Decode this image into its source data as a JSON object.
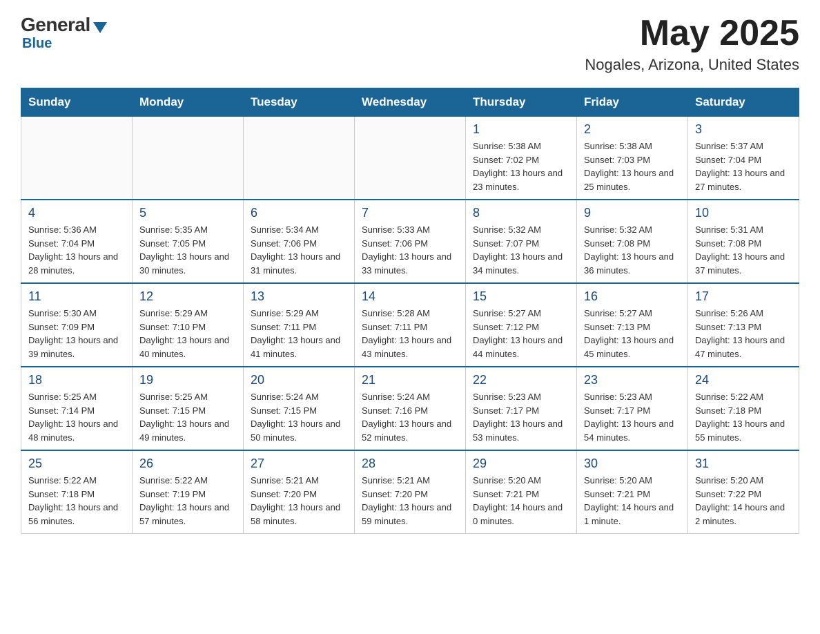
{
  "logo": {
    "general": "General",
    "blue": "Blue"
  },
  "title": "May 2025",
  "subtitle": "Nogales, Arizona, United States",
  "days_of_week": [
    "Sunday",
    "Monday",
    "Tuesday",
    "Wednesday",
    "Thursday",
    "Friday",
    "Saturday"
  ],
  "weeks": [
    [
      {
        "day": "",
        "info": ""
      },
      {
        "day": "",
        "info": ""
      },
      {
        "day": "",
        "info": ""
      },
      {
        "day": "",
        "info": ""
      },
      {
        "day": "1",
        "info": "Sunrise: 5:38 AM\nSunset: 7:02 PM\nDaylight: 13 hours and 23 minutes."
      },
      {
        "day": "2",
        "info": "Sunrise: 5:38 AM\nSunset: 7:03 PM\nDaylight: 13 hours and 25 minutes."
      },
      {
        "day": "3",
        "info": "Sunrise: 5:37 AM\nSunset: 7:04 PM\nDaylight: 13 hours and 27 minutes."
      }
    ],
    [
      {
        "day": "4",
        "info": "Sunrise: 5:36 AM\nSunset: 7:04 PM\nDaylight: 13 hours and 28 minutes."
      },
      {
        "day": "5",
        "info": "Sunrise: 5:35 AM\nSunset: 7:05 PM\nDaylight: 13 hours and 30 minutes."
      },
      {
        "day": "6",
        "info": "Sunrise: 5:34 AM\nSunset: 7:06 PM\nDaylight: 13 hours and 31 minutes."
      },
      {
        "day": "7",
        "info": "Sunrise: 5:33 AM\nSunset: 7:06 PM\nDaylight: 13 hours and 33 minutes."
      },
      {
        "day": "8",
        "info": "Sunrise: 5:32 AM\nSunset: 7:07 PM\nDaylight: 13 hours and 34 minutes."
      },
      {
        "day": "9",
        "info": "Sunrise: 5:32 AM\nSunset: 7:08 PM\nDaylight: 13 hours and 36 minutes."
      },
      {
        "day": "10",
        "info": "Sunrise: 5:31 AM\nSunset: 7:08 PM\nDaylight: 13 hours and 37 minutes."
      }
    ],
    [
      {
        "day": "11",
        "info": "Sunrise: 5:30 AM\nSunset: 7:09 PM\nDaylight: 13 hours and 39 minutes."
      },
      {
        "day": "12",
        "info": "Sunrise: 5:29 AM\nSunset: 7:10 PM\nDaylight: 13 hours and 40 minutes."
      },
      {
        "day": "13",
        "info": "Sunrise: 5:29 AM\nSunset: 7:11 PM\nDaylight: 13 hours and 41 minutes."
      },
      {
        "day": "14",
        "info": "Sunrise: 5:28 AM\nSunset: 7:11 PM\nDaylight: 13 hours and 43 minutes."
      },
      {
        "day": "15",
        "info": "Sunrise: 5:27 AM\nSunset: 7:12 PM\nDaylight: 13 hours and 44 minutes."
      },
      {
        "day": "16",
        "info": "Sunrise: 5:27 AM\nSunset: 7:13 PM\nDaylight: 13 hours and 45 minutes."
      },
      {
        "day": "17",
        "info": "Sunrise: 5:26 AM\nSunset: 7:13 PM\nDaylight: 13 hours and 47 minutes."
      }
    ],
    [
      {
        "day": "18",
        "info": "Sunrise: 5:25 AM\nSunset: 7:14 PM\nDaylight: 13 hours and 48 minutes."
      },
      {
        "day": "19",
        "info": "Sunrise: 5:25 AM\nSunset: 7:15 PM\nDaylight: 13 hours and 49 minutes."
      },
      {
        "day": "20",
        "info": "Sunrise: 5:24 AM\nSunset: 7:15 PM\nDaylight: 13 hours and 50 minutes."
      },
      {
        "day": "21",
        "info": "Sunrise: 5:24 AM\nSunset: 7:16 PM\nDaylight: 13 hours and 52 minutes."
      },
      {
        "day": "22",
        "info": "Sunrise: 5:23 AM\nSunset: 7:17 PM\nDaylight: 13 hours and 53 minutes."
      },
      {
        "day": "23",
        "info": "Sunrise: 5:23 AM\nSunset: 7:17 PM\nDaylight: 13 hours and 54 minutes."
      },
      {
        "day": "24",
        "info": "Sunrise: 5:22 AM\nSunset: 7:18 PM\nDaylight: 13 hours and 55 minutes."
      }
    ],
    [
      {
        "day": "25",
        "info": "Sunrise: 5:22 AM\nSunset: 7:18 PM\nDaylight: 13 hours and 56 minutes."
      },
      {
        "day": "26",
        "info": "Sunrise: 5:22 AM\nSunset: 7:19 PM\nDaylight: 13 hours and 57 minutes."
      },
      {
        "day": "27",
        "info": "Sunrise: 5:21 AM\nSunset: 7:20 PM\nDaylight: 13 hours and 58 minutes."
      },
      {
        "day": "28",
        "info": "Sunrise: 5:21 AM\nSunset: 7:20 PM\nDaylight: 13 hours and 59 minutes."
      },
      {
        "day": "29",
        "info": "Sunrise: 5:20 AM\nSunset: 7:21 PM\nDaylight: 14 hours and 0 minutes."
      },
      {
        "day": "30",
        "info": "Sunrise: 5:20 AM\nSunset: 7:21 PM\nDaylight: 14 hours and 1 minute."
      },
      {
        "day": "31",
        "info": "Sunrise: 5:20 AM\nSunset: 7:22 PM\nDaylight: 14 hours and 2 minutes."
      }
    ]
  ]
}
